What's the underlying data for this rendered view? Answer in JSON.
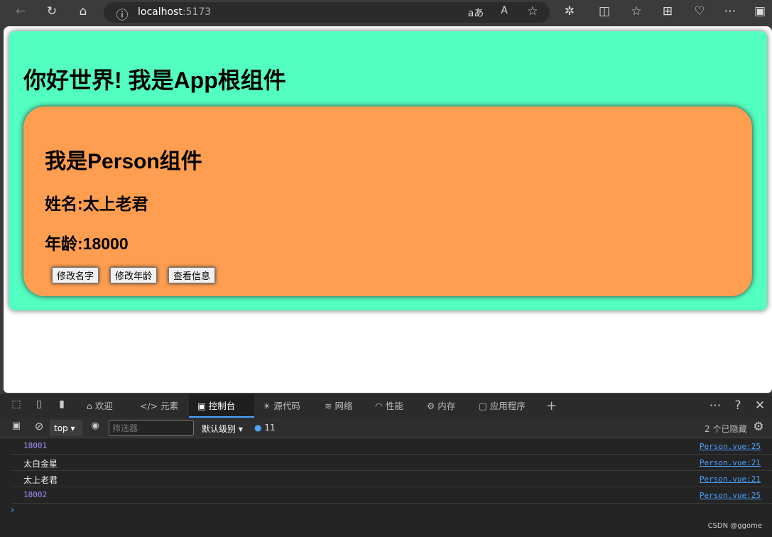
{
  "browser": {
    "url_host": "localhost",
    "url_port": ":5173"
  },
  "app": {
    "title": "你好世界! 我是App根组件",
    "person": {
      "title": "我是Person组件",
      "name_line": "姓名:太上老君",
      "age_line": "年龄:18000",
      "buttons": [
        "修改名字",
        "修改年龄",
        "查看信息"
      ]
    }
  },
  "devtools": {
    "tabs": [
      "欢迎",
      "元素",
      "控制台",
      "源代码",
      "网络",
      "性能",
      "内存",
      "应用程序"
    ],
    "active_tab": "控制台",
    "context": "top",
    "filter_placeholder": "筛选器",
    "level": "默认级别",
    "message_count": "11",
    "hidden": "2 个已隐藏",
    "logs": [
      {
        "text": "18001",
        "type": "number",
        "source": "Person.vue:25"
      },
      {
        "text": "太白金星",
        "type": "string",
        "source": "Person.vue:21"
      },
      {
        "text": "太上老君",
        "type": "string",
        "source": "Person.vue:21"
      },
      {
        "text": "18002",
        "type": "number",
        "source": "Person.vue:25"
      }
    ]
  },
  "watermark": "CSDN @ggome"
}
